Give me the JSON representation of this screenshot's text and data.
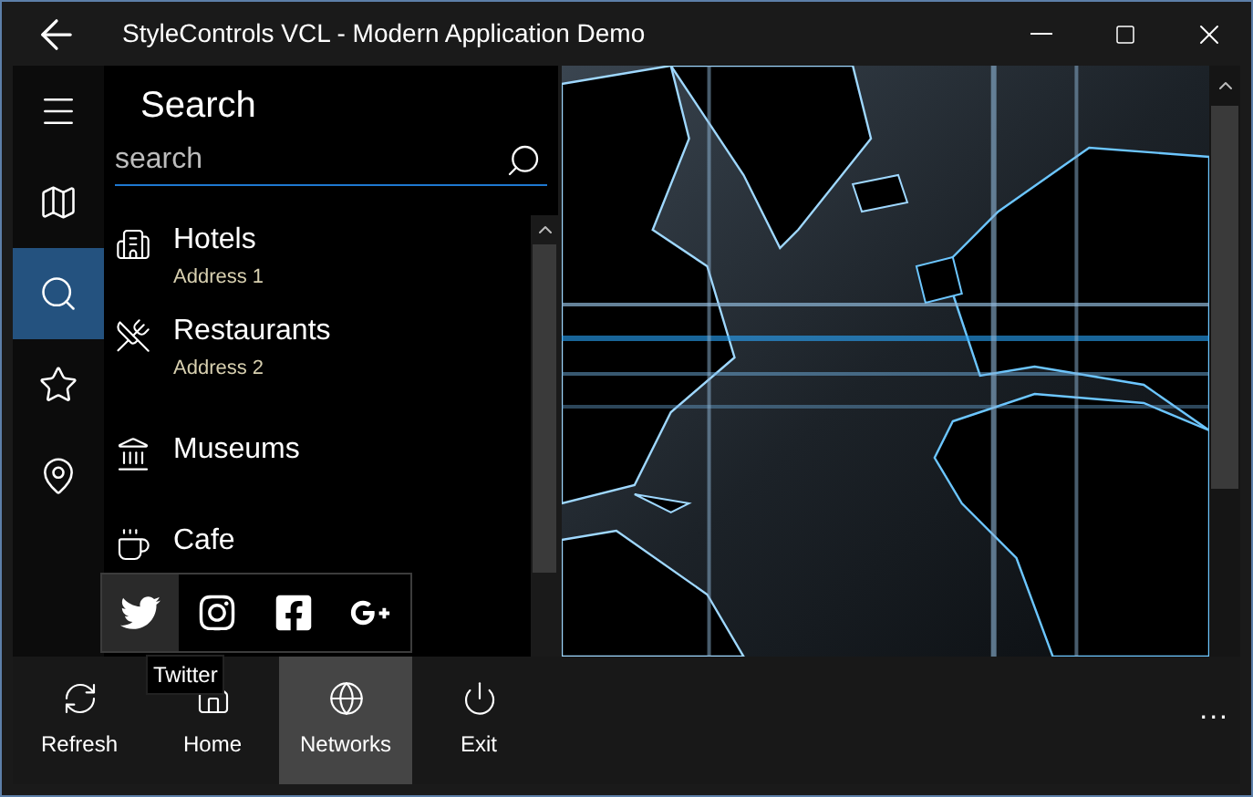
{
  "window": {
    "title": "StyleControls VCL - Modern Application Demo"
  },
  "nav_rail": [
    {
      "kind": "menu",
      "selected": false
    },
    {
      "kind": "map",
      "selected": false
    },
    {
      "kind": "search",
      "selected": true
    },
    {
      "kind": "favorites",
      "selected": false
    },
    {
      "kind": "location",
      "selected": false
    }
  ],
  "search_panel": {
    "title": "Search",
    "search": {
      "placeholder": "search"
    },
    "items": [
      {
        "kind": "hotel",
        "name": "Hotels",
        "address": "Address 1"
      },
      {
        "kind": "restaurant",
        "name": "Restaurants",
        "address": "Address 2"
      },
      {
        "kind": "museum",
        "name": "Museums"
      },
      {
        "kind": "cafe",
        "name": "Cafe"
      }
    ]
  },
  "share_popup": {
    "items": [
      {
        "kind": "twitter",
        "selected": true
      },
      {
        "kind": "instagram",
        "selected": false
      },
      {
        "kind": "facebook",
        "selected": false
      },
      {
        "kind": "googleplus",
        "selected": false
      }
    ],
    "tooltip": "Twitter"
  },
  "bottom_bar": {
    "buttons": [
      {
        "kind": "refresh",
        "label": "Refresh",
        "selected": false
      },
      {
        "kind": "home",
        "label": "Home",
        "selected": false
      },
      {
        "kind": "networks",
        "label": "Networks",
        "selected": true
      },
      {
        "kind": "exit",
        "label": "Exit",
        "selected": false
      }
    ],
    "more": "..."
  }
}
